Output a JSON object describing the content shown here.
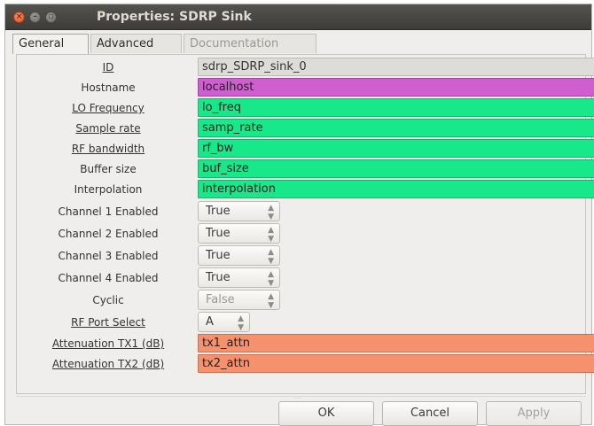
{
  "window": {
    "title": "Properties: SDRP Sink"
  },
  "tabs": [
    {
      "label": "General"
    },
    {
      "label": "Advanced"
    },
    {
      "label": "Documentation"
    }
  ],
  "params": {
    "id": {
      "label": "ID",
      "value": "sdrp_SDRP_sink_0"
    },
    "hostname": {
      "label": "Hostname",
      "value": "localhost"
    },
    "lo_freq": {
      "label": "LO Frequency",
      "value": "lo_freq"
    },
    "samp_rate": {
      "label": "Sample rate",
      "value": "samp_rate"
    },
    "rf_bw": {
      "label": "RF bandwidth",
      "value": "rf_bw"
    },
    "buf_size": {
      "label": "Buffer size",
      "value": "buf_size"
    },
    "interpolation": {
      "label": "Interpolation",
      "value": "interpolation"
    },
    "ch1": {
      "label": "Channel 1 Enabled",
      "value": "True"
    },
    "ch2": {
      "label": "Channel 2 Enabled",
      "value": "True"
    },
    "ch3": {
      "label": "Channel 3 Enabled",
      "value": "True"
    },
    "ch4": {
      "label": "Channel 4 Enabled",
      "value": "True"
    },
    "cyclic": {
      "label": "Cyclic",
      "value": "False"
    },
    "rf_port": {
      "label": "RF Port Select",
      "value": "A"
    },
    "atten_tx1": {
      "label": "Attenuation TX1 (dB)",
      "value": "tx1_attn"
    },
    "atten_tx2": {
      "label": "Attenuation TX2 (dB)",
      "value": "tx2_attn"
    }
  },
  "buttons": {
    "ok": "OK",
    "cancel": "Cancel",
    "apply": "Apply"
  },
  "colors": {
    "string_param": "#cf5fcf",
    "float_param": "#17e88a",
    "real_param": "#f6916e",
    "readonly_param": "#dddcd8"
  }
}
